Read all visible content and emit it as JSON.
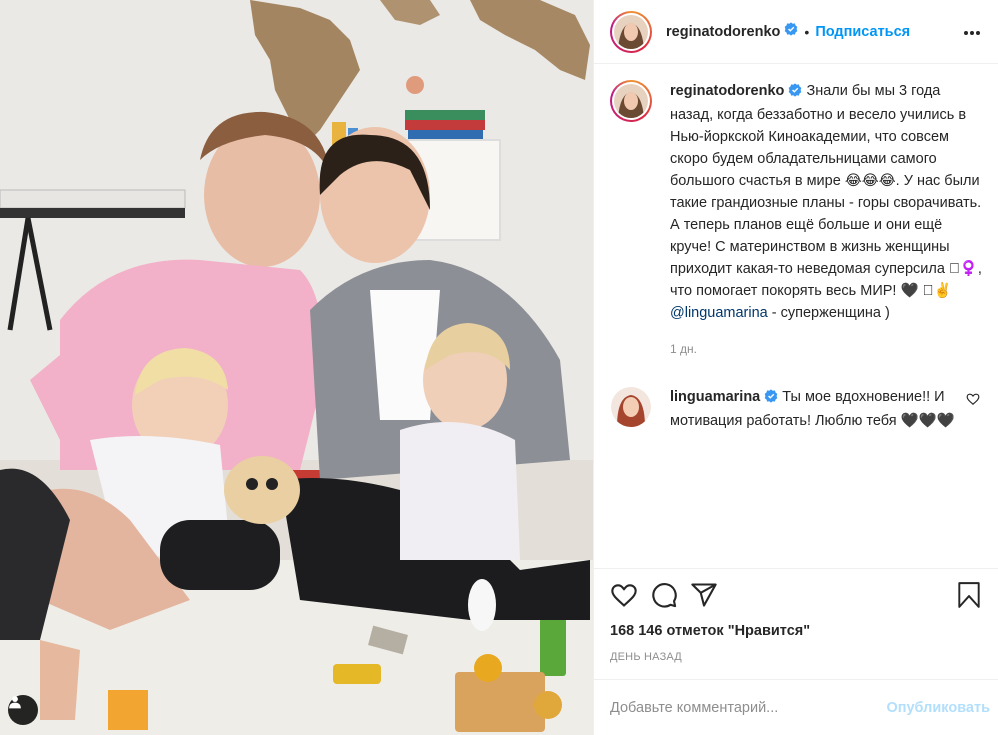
{
  "post": {
    "author": "reginatodorenko",
    "follow_label": "Подписаться",
    "caption_author": "reginatodorenko",
    "caption_text": "Знали бы мы 3 года назад, когда беззаботно и весело учились в Нью-йоркской Киноакадемии, что совсем скоро будем обладательницами самого большого счастья в мире 😂😂😂. У нас были такие грандиозные планы - горы сворачивать. А теперь планов ещё больше и они ещё круче! С материнством в жизнь женщины приходит какая-то неведомая суперсила 🏻‍♀️, что помогает покорять весь МИР! 🖤 🏻✌️",
    "caption_mention": "@linguamarina",
    "caption_tail": " - суперженщина )",
    "caption_time": "1 дн.",
    "reply": {
      "author": "linguamarina",
      "text": "Ты мое вдохновение!! И мотивация работать! Люблю тебя 🖤🖤🖤"
    },
    "likes_label": "168 146 отметок \"Нравится\"",
    "posted_ago": "День назад",
    "comment_placeholder": "Добавьте комментарий...",
    "post_button": "Опубликовать"
  },
  "icons": {
    "verified": "verified-badge-icon",
    "more": "more-options-icon",
    "like": "heart-icon",
    "comment": "comment-icon",
    "share": "share-icon",
    "save": "bookmark-icon",
    "tag": "user-tag-icon"
  },
  "colors": {
    "link": "#0095f6",
    "verified": "#3897f0",
    "mention": "#00376b",
    "muted": "#8e8e8e"
  }
}
